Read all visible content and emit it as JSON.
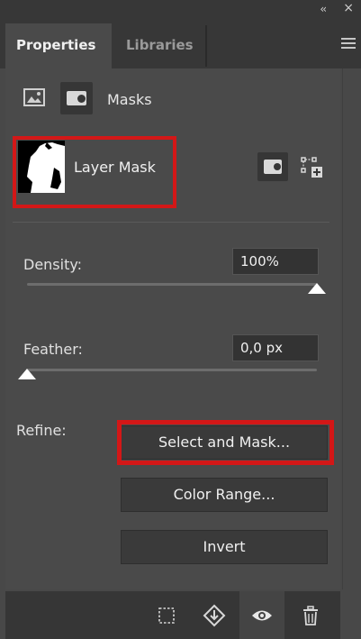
{
  "window": {
    "collapse_glyph": "‹‹",
    "close_glyph": "×"
  },
  "tabs": [
    {
      "label": "Properties",
      "active": true
    },
    {
      "label": "Libraries",
      "active": false
    }
  ],
  "section": {
    "mode_label": "Masks",
    "mode_icons": [
      "pixel-mask-icon",
      "layer-mask-icon"
    ]
  },
  "mask": {
    "label": "Layer Mask",
    "actions": [
      "add-pixel-mask-icon",
      "add-vector-mask-icon"
    ]
  },
  "density": {
    "label": "Density:",
    "value": "100%",
    "level_percent": 100
  },
  "feather": {
    "label": "Feather:",
    "value": "0,0 px",
    "level_percent": 0
  },
  "refine": {
    "label": "Refine:",
    "buttons": {
      "select_mask": "Select and Mask...",
      "color_range": "Color Range...",
      "invert": "Invert"
    }
  },
  "bottom_icons": [
    "load-selection-icon",
    "apply-mask-icon",
    "visibility-icon",
    "delete-icon"
  ],
  "colors": {
    "highlight": "#d31717",
    "panel": "#4a4a4a",
    "bar": "#373737"
  }
}
